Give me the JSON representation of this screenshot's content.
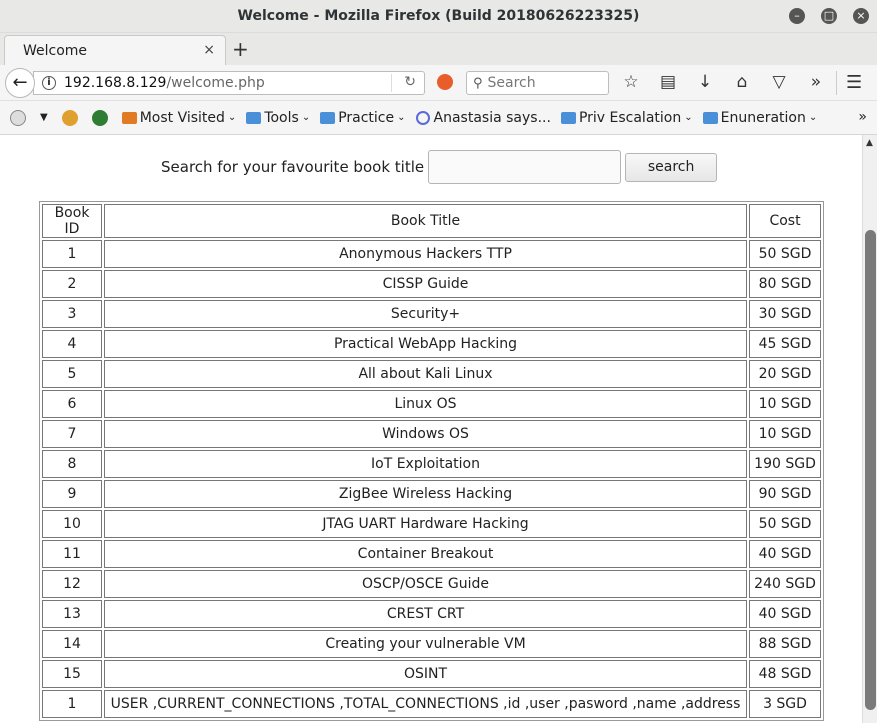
{
  "window": {
    "title": "Welcome - Mozilla Firefox (Build 20180626223325)"
  },
  "tab": {
    "label": "Welcome"
  },
  "url": {
    "host": "192.168.8.129",
    "path": "/welcome.php"
  },
  "searchbar": {
    "placeholder": "Search"
  },
  "bookmarks": {
    "items": [
      {
        "label": "Most Visited"
      },
      {
        "label": "Tools"
      },
      {
        "label": "Practice"
      },
      {
        "label": "Anastasia says..."
      },
      {
        "label": "Priv Escalation"
      },
      {
        "label": "Enuneration"
      }
    ]
  },
  "page": {
    "search_label": "Search for your favourite book title",
    "search_value": "",
    "search_button": "search"
  },
  "table": {
    "headers": [
      "Book ID",
      "Book Title",
      "Cost"
    ],
    "rows": [
      [
        "1",
        "Anonymous Hackers TTP",
        "50 SGD"
      ],
      [
        "2",
        "CISSP Guide",
        "80 SGD"
      ],
      [
        "3",
        "Security+",
        "30 SGD"
      ],
      [
        "4",
        "Practical WebApp Hacking",
        "45 SGD"
      ],
      [
        "5",
        "All about Kali Linux",
        "20 SGD"
      ],
      [
        "6",
        "Linux OS",
        "10 SGD"
      ],
      [
        "7",
        "Windows OS",
        "10 SGD"
      ],
      [
        "8",
        "IoT Exploitation",
        "190 SGD"
      ],
      [
        "9",
        "ZigBee Wireless Hacking",
        "90 SGD"
      ],
      [
        "10",
        "JTAG UART Hardware Hacking",
        "50 SGD"
      ],
      [
        "11",
        "Container Breakout",
        "40 SGD"
      ],
      [
        "12",
        "OSCP/OSCE Guide",
        "240 SGD"
      ],
      [
        "13",
        "CREST CRT",
        "40 SGD"
      ],
      [
        "14",
        "Creating your vulnerable VM",
        "88 SGD"
      ],
      [
        "15",
        "OSINT",
        "48 SGD"
      ],
      [
        "1",
        "USER ,CURRENT_CONNECTIONS ,TOTAL_CONNECTIONS ,id ,user ,pasword ,name ,address",
        "3 SGD"
      ]
    ]
  }
}
